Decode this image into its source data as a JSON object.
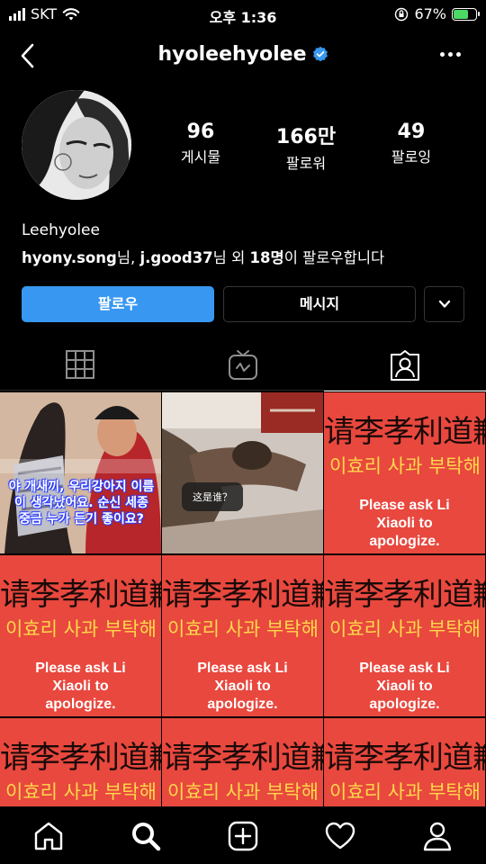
{
  "status_bar": {
    "carrier": "SKT",
    "time": "오후 1:36",
    "battery": "67%",
    "battery_level": 0.67
  },
  "header": {
    "username": "hyoleehyolee",
    "verified": true,
    "back_icon": "chevron-left-icon",
    "more_icon": "more-horizontal-icon"
  },
  "profile": {
    "stats": [
      {
        "value": "96",
        "label": "게시물"
      },
      {
        "value": "166만",
        "label": "팔로워"
      },
      {
        "value": "49",
        "label": "팔로잉"
      }
    ],
    "name": "Leehyolee",
    "followed_by": {
      "user1": "hyony.song",
      "suffix1": "님, ",
      "user2": "j.good37",
      "suffix2": "님 외 ",
      "count": "18명",
      "suffix3": "이 팔로우합니다"
    }
  },
  "actions": {
    "follow_label": "팔로우",
    "message_label": "메시지"
  },
  "tabs": [
    {
      "name": "grid-icon",
      "active": false
    },
    {
      "name": "igtv-icon",
      "active": false
    },
    {
      "name": "tagged-icon",
      "active": true
    }
  ],
  "posts": {
    "post1_caption": "야 개새끼, 우리강아지 이름이 생각났어요. 순신 세종 중금 누가 든기 좋이요?",
    "post2_tag": "这是谁？",
    "protest": {
      "zh": "请李孝利道歉",
      "kr": "이효리 사과 부탁해",
      "en": "Please ask Li Xiaoli to apologize."
    }
  },
  "colors": {
    "accent": "#3897f0",
    "protest_red": "#e8483e",
    "protest_yellow": "#ffd84a",
    "battery_green": "#4cd964"
  },
  "bottom_nav": [
    "home-icon",
    "search-icon",
    "add-post-icon",
    "activity-heart-icon",
    "profile-icon"
  ]
}
